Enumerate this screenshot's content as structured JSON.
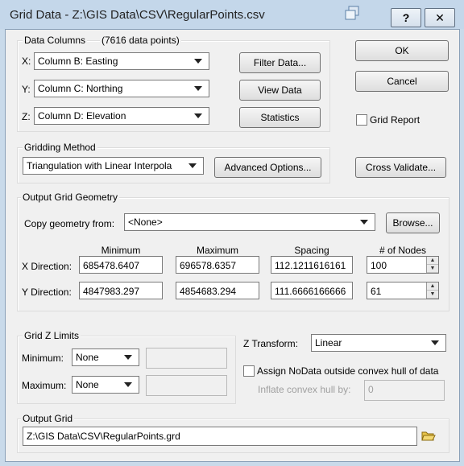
{
  "window": {
    "title": "Grid Data - Z:\\GIS Data\\CSV\\RegularPoints.csv",
    "help": "?",
    "close": "✕"
  },
  "data_columns": {
    "label": "Data Columns",
    "count": "(7616 data points)",
    "x_label": "X:",
    "x_value": "Column B:  Easting",
    "y_label": "Y:",
    "y_value": "Column C:  Northing",
    "z_label": "Z:",
    "z_value": "Column D:  Elevation",
    "filter": "Filter Data...",
    "view": "View Data",
    "stats": "Statistics"
  },
  "side": {
    "ok": "OK",
    "cancel": "Cancel",
    "grid_report": "Grid Report",
    "cross_validate": "Cross Validate..."
  },
  "gridding": {
    "label": "Gridding Method",
    "method": "Triangulation with Linear Interpola",
    "advanced": "Advanced Options..."
  },
  "geometry": {
    "label": "Output Grid Geometry",
    "copy_label": "Copy geometry from:",
    "copy_value": "<None>",
    "browse": "Browse...",
    "headers": {
      "min": "Minimum",
      "max": "Maximum",
      "spacing": "Spacing",
      "nodes": "# of Nodes"
    },
    "x": {
      "label": "X Direction:",
      "min": "685478.6407",
      "max": "696578.6357",
      "spacing": "112.1211616161",
      "nodes": "100"
    },
    "y": {
      "label": "Y Direction:",
      "min": "4847983.297",
      "max": "4854683.294",
      "spacing": "111.6666166666",
      "nodes": "61"
    }
  },
  "zlimits": {
    "label": "Grid Z Limits",
    "min_label": "Minimum:",
    "min_value": "None",
    "max_label": "Maximum:",
    "max_value": "None"
  },
  "ztransform": {
    "label": "Z Transform:",
    "value": "Linear"
  },
  "nodata": {
    "label": "Assign NoData outside convex hull of data",
    "inflate_label": "Inflate convex hull by:",
    "inflate_value": "0"
  },
  "output": {
    "label": "Output Grid",
    "path": "Z:\\GIS Data\\CSV\\RegularPoints.grd"
  }
}
